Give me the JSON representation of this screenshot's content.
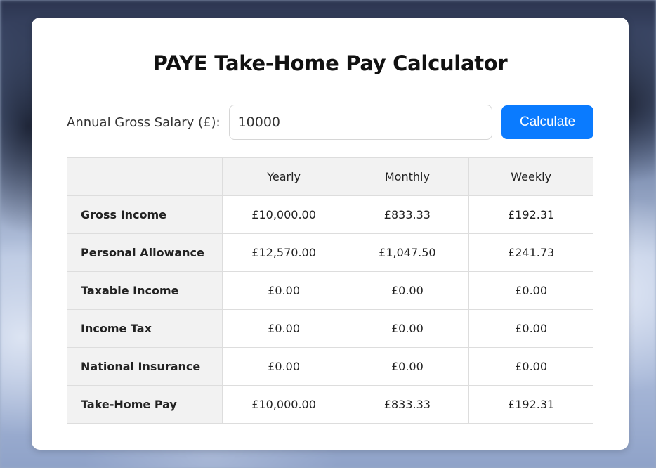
{
  "title": "PAYE Take-Home Pay Calculator",
  "form": {
    "label": "Annual Gross Salary (£):",
    "input_value": "10000",
    "button_label": "Calculate"
  },
  "colors": {
    "accent": "#0a7bff",
    "header_bg": "#f2f2f2",
    "border": "#dddddd"
  },
  "table": {
    "headers": [
      "",
      "Yearly",
      "Monthly",
      "Weekly"
    ],
    "rows": [
      {
        "label": "Gross Income",
        "yearly": "£10,000.00",
        "monthly": "£833.33",
        "weekly": "£192.31"
      },
      {
        "label": "Personal Allowance",
        "yearly": "£12,570.00",
        "monthly": "£1,047.50",
        "weekly": "£241.73"
      },
      {
        "label": "Taxable Income",
        "yearly": "£0.00",
        "monthly": "£0.00",
        "weekly": "£0.00"
      },
      {
        "label": "Income Tax",
        "yearly": "£0.00",
        "monthly": "£0.00",
        "weekly": "£0.00"
      },
      {
        "label": "National Insurance",
        "yearly": "£0.00",
        "monthly": "£0.00",
        "weekly": "£0.00"
      },
      {
        "label": "Take-Home Pay",
        "yearly": "£10,000.00",
        "monthly": "£833.33",
        "weekly": "£192.31"
      }
    ]
  }
}
